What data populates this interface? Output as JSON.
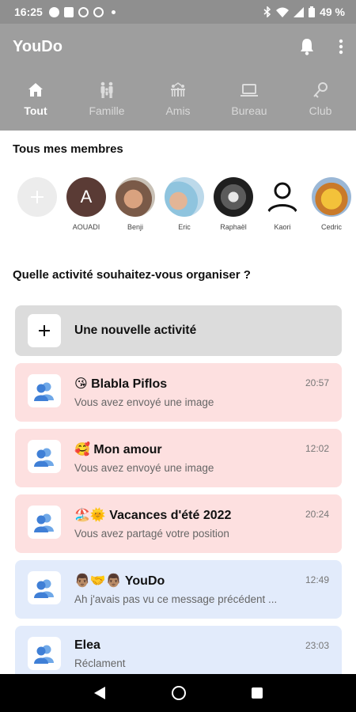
{
  "status_bar": {
    "time": "16:25",
    "battery": "49 %"
  },
  "app": {
    "title": "YouDo"
  },
  "tabs": [
    {
      "label": "Tout",
      "icon": "home-icon",
      "active": true
    },
    {
      "label": "Famille",
      "icon": "family-icon",
      "active": false
    },
    {
      "label": "Amis",
      "icon": "friends-icon",
      "active": false
    },
    {
      "label": "Bureau",
      "icon": "laptop-icon",
      "active": false
    },
    {
      "label": "Club",
      "icon": "club-icon",
      "active": false
    }
  ],
  "members": {
    "title": "Tous mes membres",
    "add_icon": "plus-icon",
    "items": [
      {
        "name": "AOUADI",
        "initial": "A"
      },
      {
        "name": "Benji"
      },
      {
        "name": "Eric"
      },
      {
        "name": "Raphaël"
      },
      {
        "name": "Kaori"
      },
      {
        "name": "Cedric"
      }
    ]
  },
  "activities": {
    "prompt": "Quelle activité souhaitez-vous organiser ?",
    "new_label": "Une nouvelle activité",
    "items": [
      {
        "title": "😘 Blabla Piflos",
        "subtitle": "Vous avez envoyé une image",
        "time": "20:57",
        "color": "pink"
      },
      {
        "title": "🥰 Mon amour",
        "subtitle": "Vous avez envoyé une image",
        "time": "12:02",
        "color": "pink"
      },
      {
        "title": "🏖️🌞 Vacances d'été 2022",
        "subtitle": "Vous avez partagé votre position",
        "time": "20:24",
        "color": "pink"
      },
      {
        "title": "👨🏽‍🤝‍👨🏽 YouDo",
        "subtitle": "Ah j'avais pas vu ce message précédent ...",
        "time": "12:49",
        "color": "blue"
      },
      {
        "title": "Elea",
        "subtitle": "Réclament",
        "time": "23:03",
        "color": "blue"
      }
    ]
  },
  "colors": {
    "app_bar": "#9e9e9e",
    "pink_card": "#fde0e0",
    "blue_card": "#e2ebfb",
    "group_icon": "#4a90e2"
  }
}
